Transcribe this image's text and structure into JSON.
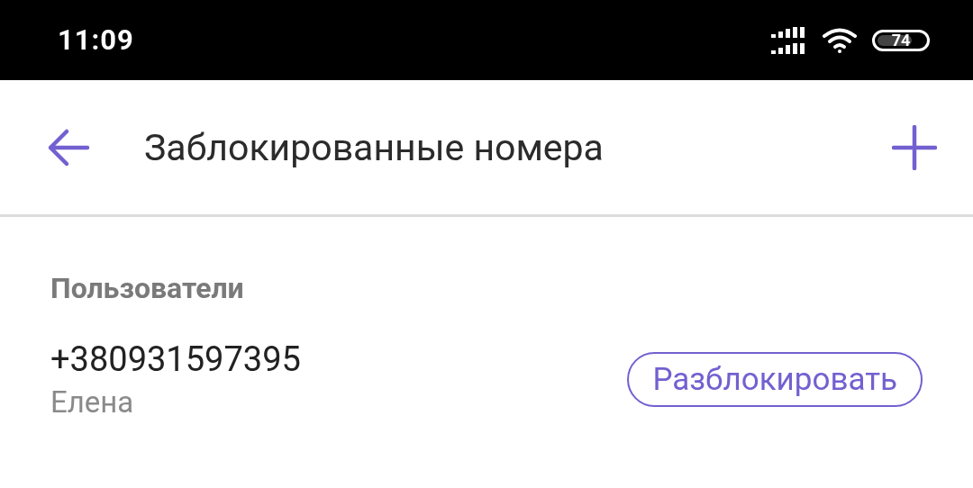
{
  "status_bar": {
    "time": "11:09",
    "battery": "74"
  },
  "app_bar": {
    "title": "Заблокированные номера"
  },
  "section": {
    "title": "Пользователи"
  },
  "contacts": [
    {
      "number": "+380931597395",
      "name": "Елена",
      "action": "Разблокировать"
    }
  ]
}
